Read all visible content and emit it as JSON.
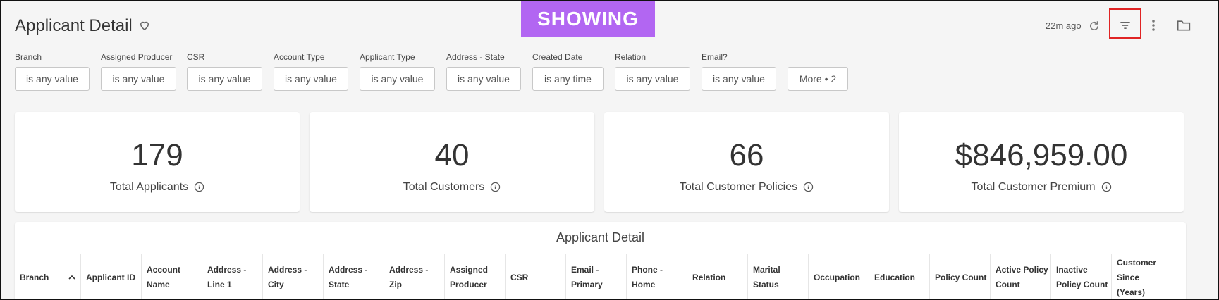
{
  "header": {
    "title": "Applicant Detail",
    "badge": "SHOWING",
    "updated": "22m ago"
  },
  "filters": [
    {
      "label": "Branch",
      "value": "is any value"
    },
    {
      "label": "Assigned Producer",
      "value": "is any value"
    },
    {
      "label": "CSR",
      "value": "is any value"
    },
    {
      "label": "Account Type",
      "value": "is any value"
    },
    {
      "label": "Applicant Type",
      "value": "is any value"
    },
    {
      "label": "Address - State",
      "value": "is any value"
    },
    {
      "label": "Created Date",
      "value": "is any time"
    },
    {
      "label": "Relation",
      "value": "is any value"
    },
    {
      "label": "Email?",
      "value": "is any value"
    }
  ],
  "more_filters": "More • 2",
  "kpis": [
    {
      "value": "179",
      "label": "Total Applicants"
    },
    {
      "value": "40",
      "label": "Total Customers"
    },
    {
      "value": "66",
      "label": "Total Customer Policies"
    },
    {
      "value": "$846,959.00",
      "label": "Total Customer Premium"
    }
  ],
  "table": {
    "title": "Applicant Detail",
    "columns": [
      "Branch",
      "Applicant ID",
      "Account Name",
      "Address - Line 1",
      "Address - City",
      "Address - State",
      "Address - Zip",
      "Assigned Producer",
      "CSR",
      "Email - Primary",
      "Phone - Home",
      "Relation",
      "Marital Status",
      "Occupation",
      "Education",
      "Policy Count",
      "Active Policy Count",
      "Inactive Policy Count",
      "Customer Since (Years)"
    ]
  },
  "icons": {
    "heart": "heart-icon",
    "refresh": "refresh-icon",
    "filter": "filter-icon",
    "more": "more-vert-icon",
    "folder": "folder-icon",
    "info": "info-icon",
    "sort": "sort-ascending-icon"
  },
  "colors": {
    "badge_bg": "#b266f2",
    "highlight": "#e02424"
  }
}
